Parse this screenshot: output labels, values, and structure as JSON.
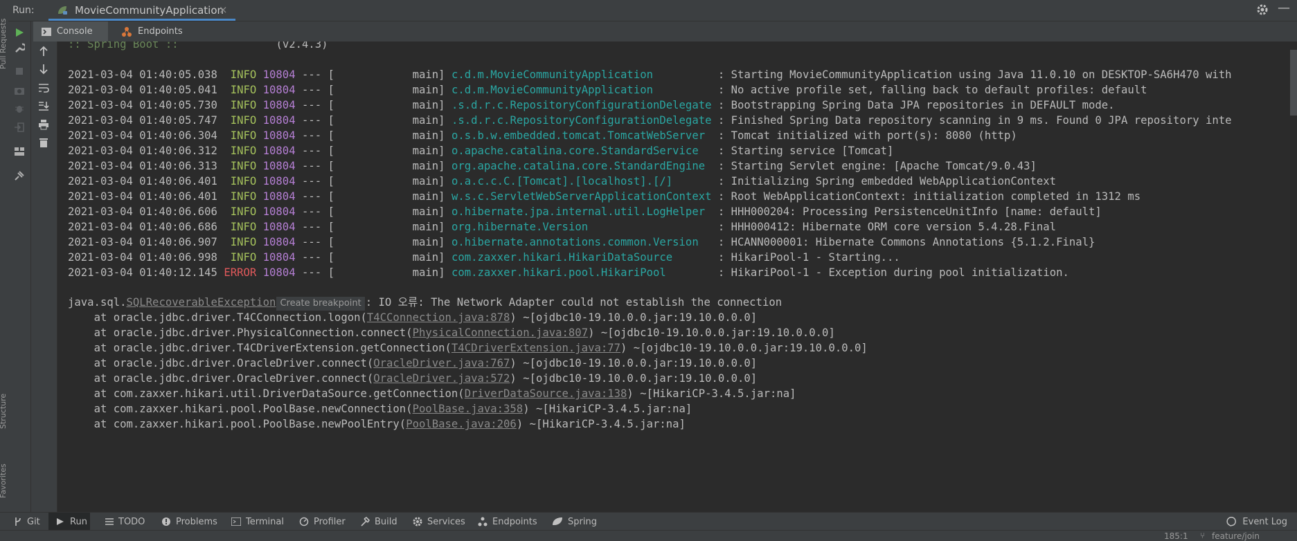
{
  "left_stripe": {
    "top_label": "Pull Requests",
    "middle_label": "Structure",
    "bottom_label": "Favorites"
  },
  "run_header": {
    "label": "Run:",
    "config_name": "MovieCommunityApplication",
    "close_glyph": "×"
  },
  "console_tabs": [
    {
      "label": "Console",
      "icon": "console-icon"
    },
    {
      "label": "Endpoints",
      "icon": "endpoints-icon"
    }
  ],
  "console": {
    "banner_prefix": ":: Spring Boot ::",
    "banner_version": "(v2.4.3)",
    "log_lines": [
      {
        "ts": "2021-03-04 01:40:05.038",
        "level": "INFO",
        "pid": "10804",
        "sep": "--- [",
        "thread": "main]",
        "logger": "c.d.m.MovieCommunityApplication",
        "message": ": Starting MovieCommunityApplication using Java 11.0.10 on DESKTOP-SA6H470 with"
      },
      {
        "ts": "2021-03-04 01:40:05.041",
        "level": "INFO",
        "pid": "10804",
        "sep": "--- [",
        "thread": "main]",
        "logger": "c.d.m.MovieCommunityApplication",
        "message": ": No active profile set, falling back to default profiles: default"
      },
      {
        "ts": "2021-03-04 01:40:05.730",
        "level": "INFO",
        "pid": "10804",
        "sep": "--- [",
        "thread": "main]",
        "logger": ".s.d.r.c.RepositoryConfigurationDelegate",
        "message": ": Bootstrapping Spring Data JPA repositories in DEFAULT mode."
      },
      {
        "ts": "2021-03-04 01:40:05.747",
        "level": "INFO",
        "pid": "10804",
        "sep": "--- [",
        "thread": "main]",
        "logger": ".s.d.r.c.RepositoryConfigurationDelegate",
        "message": ": Finished Spring Data repository scanning in 9 ms. Found 0 JPA repository inte"
      },
      {
        "ts": "2021-03-04 01:40:06.304",
        "level": "INFO",
        "pid": "10804",
        "sep": "--- [",
        "thread": "main]",
        "logger": "o.s.b.w.embedded.tomcat.TomcatWebServer",
        "message": ": Tomcat initialized with port(s): 8080 (http)"
      },
      {
        "ts": "2021-03-04 01:40:06.312",
        "level": "INFO",
        "pid": "10804",
        "sep": "--- [",
        "thread": "main]",
        "logger": "o.apache.catalina.core.StandardService",
        "message": ": Starting service [Tomcat]"
      },
      {
        "ts": "2021-03-04 01:40:06.313",
        "level": "INFO",
        "pid": "10804",
        "sep": "--- [",
        "thread": "main]",
        "logger": "org.apache.catalina.core.StandardEngine",
        "message": ": Starting Servlet engine: [Apache Tomcat/9.0.43]"
      },
      {
        "ts": "2021-03-04 01:40:06.401",
        "level": "INFO",
        "pid": "10804",
        "sep": "--- [",
        "thread": "main]",
        "logger": "o.a.c.c.C.[Tomcat].[localhost].[/]",
        "message": ": Initializing Spring embedded WebApplicationContext"
      },
      {
        "ts": "2021-03-04 01:40:06.401",
        "level": "INFO",
        "pid": "10804",
        "sep": "--- [",
        "thread": "main]",
        "logger": "w.s.c.ServletWebServerApplicationContext",
        "message": ": Root WebApplicationContext: initialization completed in 1312 ms"
      },
      {
        "ts": "2021-03-04 01:40:06.606",
        "level": "INFO",
        "pid": "10804",
        "sep": "--- [",
        "thread": "main]",
        "logger": "o.hibernate.jpa.internal.util.LogHelper",
        "message": ": HHH000204: Processing PersistenceUnitInfo [name: default]"
      },
      {
        "ts": "2021-03-04 01:40:06.686",
        "level": "INFO",
        "pid": "10804",
        "sep": "--- [",
        "thread": "main]",
        "logger": "org.hibernate.Version",
        "message": ": HHH000412: Hibernate ORM core version 5.4.28.Final"
      },
      {
        "ts": "2021-03-04 01:40:06.907",
        "level": "INFO",
        "pid": "10804",
        "sep": "--- [",
        "thread": "main]",
        "logger": "o.hibernate.annotations.common.Version",
        "message": ": HCANN000001: Hibernate Commons Annotations {5.1.2.Final}"
      },
      {
        "ts": "2021-03-04 01:40:06.998",
        "level": "INFO",
        "pid": "10804",
        "sep": "--- [",
        "thread": "main]",
        "logger": "com.zaxxer.hikari.HikariDataSource",
        "message": ": HikariPool-1 - Starting..."
      },
      {
        "ts": "2021-03-04 01:40:12.145",
        "level": "ERROR",
        "pid": "10804",
        "sep": "--- [",
        "thread": "main]",
        "logger": "com.zaxxer.hikari.pool.HikariPool",
        "message": ": HikariPool-1 - Exception during pool initialization."
      }
    ],
    "exception": {
      "prefix": "java.sql.",
      "class_link": "SQLRecoverableException",
      "breakpoint_label": "Create breakpoint",
      "message": ": IO 오류: The Network Adapter could not establish the connection"
    },
    "stack_frames": [
      {
        "method": "at oracle.jdbc.driver.T4CConnection.logon(",
        "file": "T4CConnection.java:878",
        "jar": ") ~[ojdbc10-19.10.0.0.jar:19.10.0.0.0]"
      },
      {
        "method": "at oracle.jdbc.driver.PhysicalConnection.connect(",
        "file": "PhysicalConnection.java:807",
        "jar": ") ~[ojdbc10-19.10.0.0.jar:19.10.0.0.0]"
      },
      {
        "method": "at oracle.jdbc.driver.T4CDriverExtension.getConnection(",
        "file": "T4CDriverExtension.java:77",
        "jar": ") ~[ojdbc10-19.10.0.0.jar:19.10.0.0.0]"
      },
      {
        "method": "at oracle.jdbc.driver.OracleDriver.connect(",
        "file": "OracleDriver.java:767",
        "jar": ") ~[ojdbc10-19.10.0.0.jar:19.10.0.0.0]"
      },
      {
        "method": "at oracle.jdbc.driver.OracleDriver.connect(",
        "file": "OracleDriver.java:572",
        "jar": ") ~[ojdbc10-19.10.0.0.jar:19.10.0.0.0]"
      },
      {
        "method": "at com.zaxxer.hikari.util.DriverDataSource.getConnection(",
        "file": "DriverDataSource.java:138",
        "jar": ") ~[HikariCP-3.4.5.jar:na]"
      },
      {
        "method": "at com.zaxxer.hikari.pool.PoolBase.newConnection(",
        "file": "PoolBase.java:358",
        "jar": ") ~[HikariCP-3.4.5.jar:na]"
      },
      {
        "method": "at com.zaxxer.hikari.pool.PoolBase.newPoolEntry(",
        "file": "PoolBase.java:206",
        "jar": ") ~[HikariCP-3.4.5.jar:na]"
      }
    ]
  },
  "bottom_tools": [
    {
      "label": "Git",
      "icon": "git-icon"
    },
    {
      "label": "Run",
      "icon": "run-icon"
    },
    {
      "label": "TODO",
      "icon": "todo-icon"
    },
    {
      "label": "Problems",
      "icon": "problems-icon"
    },
    {
      "label": "Terminal",
      "icon": "terminal-icon"
    },
    {
      "label": "Profiler",
      "icon": "profiler-icon"
    },
    {
      "label": "Build",
      "icon": "build-icon"
    },
    {
      "label": "Services",
      "icon": "services-icon"
    },
    {
      "label": "Endpoints",
      "icon": "endpoints-icon"
    },
    {
      "label": "Spring",
      "icon": "spring-icon"
    }
  ],
  "event_log_label": "Event Log",
  "status": {
    "position": "185:1",
    "branch": "feature/join"
  },
  "colors": {
    "info": "#a5c25c",
    "error": "#e0595b",
    "pid": "#b57fd4",
    "logger": "#2aa7a3",
    "accent": "#4a88c7",
    "run_green": "#5fb257",
    "background": "#2b2b2b",
    "panel": "#3c3f41"
  }
}
